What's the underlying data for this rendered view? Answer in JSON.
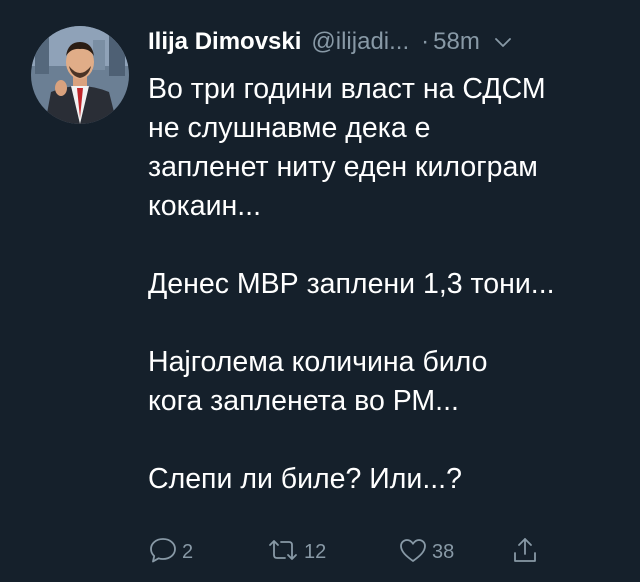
{
  "author": {
    "display_name": "Ilija Dimovski",
    "handle": "@ilijadi...",
    "separator": "·",
    "time": "58m"
  },
  "tweet": {
    "lines": [
      "Во три години власт на СДСМ",
      "не слушнавме дека е",
      "запленет ниту еден килограм",
      "кокаин...",
      "",
      "Денес МВР заплени 1,3 тони...",
      "",
      "Најголема количина било",
      "кога запленета во РМ...",
      "",
      "Слепи ли биле? Или...?"
    ]
  },
  "actions": {
    "reply_count": "2",
    "retweet_count": "12",
    "like_count": "38"
  },
  "colors": {
    "background": "#15202b",
    "text": "#ffffff",
    "secondary": "#8899a6"
  },
  "icons": [
    "avatar",
    "chevron-down-icon",
    "reply-icon",
    "retweet-icon",
    "like-icon",
    "share-icon"
  ]
}
